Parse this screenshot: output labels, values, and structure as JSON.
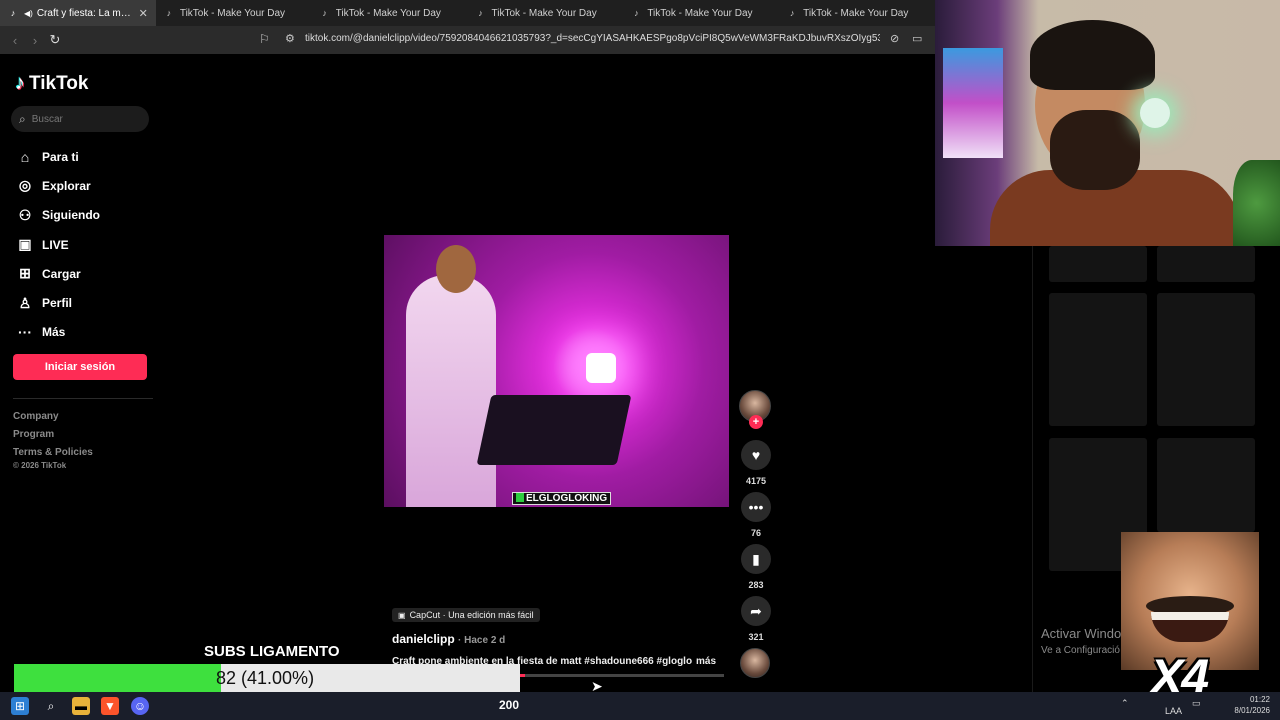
{
  "browser": {
    "tabs": [
      {
        "title": "Craft y fiesta: La mejor comb",
        "active": true
      },
      {
        "title": "TikTok - Make Your Day",
        "active": false
      },
      {
        "title": "TikTok - Make Your Day",
        "active": false
      },
      {
        "title": "TikTok - Make Your Day",
        "active": false
      },
      {
        "title": "TikTok - Make Your Day",
        "active": false
      },
      {
        "title": "TikTok - Make Your Day",
        "active": false
      }
    ],
    "url": "tiktok.com/@danielclipp/video/7592084046621035793?_d=secCgYIASAHKAESPgo8pVciPI8Q5wVeWM3FRaKDJbuvRXszOIyg53bT8hVthY%..."
  },
  "tiktok": {
    "logo": "TikTok",
    "search_placeholder": "Buscar",
    "menu": [
      {
        "label": "Para ti",
        "icon": "home-icon"
      },
      {
        "label": "Explorar",
        "icon": "compass-icon"
      },
      {
        "label": "Siguiendo",
        "icon": "following-icon"
      },
      {
        "label": "LIVE",
        "icon": "live-icon"
      },
      {
        "label": "Cargar",
        "icon": "upload-icon"
      },
      {
        "label": "Perfil",
        "icon": "profile-icon"
      },
      {
        "label": "Más",
        "icon": "more-icon"
      }
    ],
    "login_button": "Iniciar sesión",
    "footer_links": [
      "Company",
      "Program",
      "Terms & Policies"
    ],
    "copyright": "© 2026 TikTok",
    "accent_color": "#fe2c55"
  },
  "video": {
    "overlay_tag": "ELGLOGLOKING",
    "capcut_label": "CapCut · Una edición más fácil",
    "author": "danielclipp",
    "posted": "· Hace 2 d",
    "description": "Craft pone ambiente en la fiesta de matt #shadoune666 #gloglokin...",
    "more_label": "más",
    "progress": 0.4,
    "likes": "4175",
    "comments": "76",
    "saves": "283",
    "shares": "321"
  },
  "windows": {
    "activate_title": "Activar Windo",
    "activate_sub": "Ve a Configuració"
  },
  "stream_overlay": {
    "subs_title": "SUBS LIGAMENTO",
    "subs_text": "82 (41.00%)",
    "subs_fraction": 0.41,
    "meme_caption": "X4",
    "counter": "200"
  },
  "taskbar": {
    "lang": "LAA",
    "time": "01:22",
    "date": "8/01/2026"
  }
}
